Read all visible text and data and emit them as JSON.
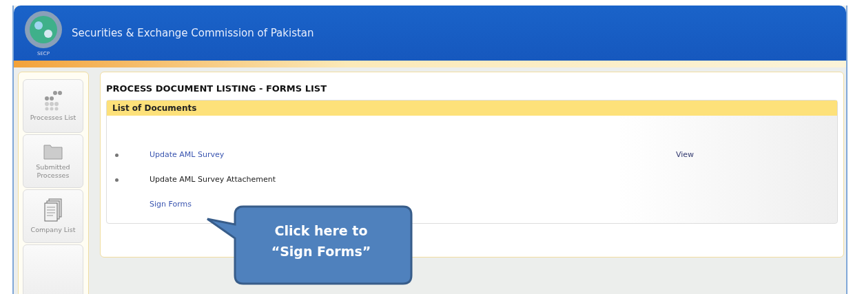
{
  "header": {
    "title": "Securities & Exchange Commission of Pakistan",
    "logo_caption": "SECP"
  },
  "sidebar": {
    "items": [
      {
        "label": "Processes List"
      },
      {
        "label": "Submitted Processes"
      },
      {
        "label": "Company List"
      }
    ]
  },
  "main": {
    "title": "PROCESS DOCUMENT LISTING - FORMS LIST",
    "section": "List of Documents",
    "documents": [
      {
        "label": "Update AML Survey",
        "bullet": true,
        "link": true,
        "action": "View"
      },
      {
        "label": "Update AML Survey Attachement",
        "bullet": true,
        "link": false
      },
      {
        "label": "Sign Forms",
        "bullet": false,
        "link": true
      }
    ]
  },
  "callout": {
    "lines": [
      "Click here to",
      "“Sign Forms”"
    ]
  }
}
